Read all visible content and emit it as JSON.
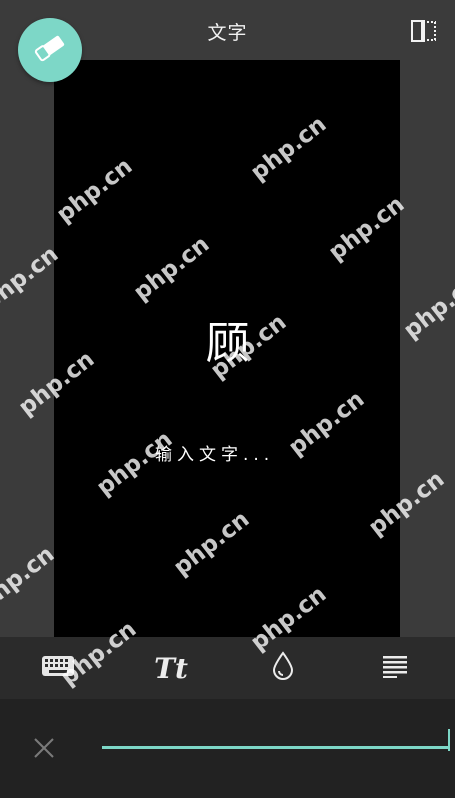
{
  "header": {
    "title": "文字"
  },
  "canvas": {
    "big_char": "顾",
    "prompt_text": "输入文字..."
  },
  "watermark": {
    "text": "php.cn"
  },
  "toolbar": {
    "items": [
      {
        "name": "keyboard-icon"
      },
      {
        "name": "text-style-icon",
        "glyph": "Tt"
      },
      {
        "name": "color-drop-icon"
      },
      {
        "name": "align-icon"
      }
    ]
  },
  "colors": {
    "accent": "#7dd7c7",
    "canvas": "#000000",
    "background": "#3b3b3b",
    "toolbar": "#2b2b2b",
    "bottom_panel": "#222222"
  }
}
